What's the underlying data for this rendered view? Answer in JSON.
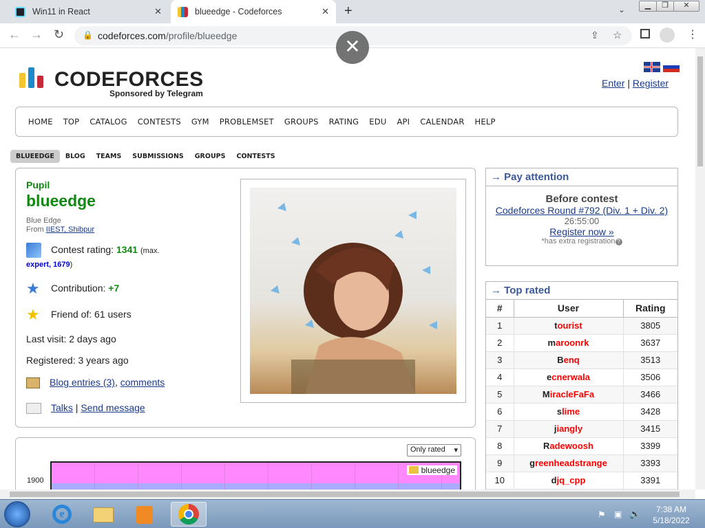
{
  "browser": {
    "tabs": [
      {
        "title": "Win11 in React"
      },
      {
        "title": "blueedge - Codeforces"
      }
    ],
    "url_domain": "codeforces.com",
    "url_path": "/profile/blueedge"
  },
  "site": {
    "logo_text": "CODEFORCES",
    "sponsor": "Sponsored by Telegram",
    "enter": "Enter",
    "register": "Register",
    "menu": [
      "HOME",
      "TOP",
      "CATALOG",
      "CONTESTS",
      "GYM",
      "PROBLEMSET",
      "GROUPS",
      "RATING",
      "EDU",
      "API",
      "CALENDAR",
      "HELP"
    ],
    "subnav": [
      "BLUEEDGE",
      "BLOG",
      "TEAMS",
      "SUBMISSIONS",
      "GROUPS",
      "CONTESTS"
    ]
  },
  "profile": {
    "rank": "Pupil",
    "handle": "blueedge",
    "real_name": "Blue Edge",
    "from_label": "From",
    "organization": "IIEST, Shibpur",
    "contest_rating_label": "Contest rating:",
    "contest_rating": "1341",
    "max_label": "(max.",
    "max_rank": "expert, 1679",
    "max_close": ")",
    "contribution_label": "Contribution:",
    "contribution": "+7",
    "friend_of": "Friend of: 61 users",
    "last_visit": "Last visit: 2 days ago",
    "registered": "Registered: 3 years ago",
    "blog_entries": "Blog entries (3)",
    "comments": "comments",
    "talks": "Talks",
    "send_message": "Send message"
  },
  "chart": {
    "filter": "Only rated",
    "ytick": "1900",
    "legend": "blueedge"
  },
  "pay_attention": {
    "header": "→ Pay attention",
    "before": "Before contest",
    "contest": "Codeforces Round #792 (Div. 1 + Div. 2)",
    "countdown": "26:55:00",
    "register_now": "Register now »",
    "note": "*has extra registration"
  },
  "top_rated": {
    "header": "→ Top rated",
    "columns": [
      "#",
      "User",
      "Rating"
    ],
    "rows": [
      {
        "rank": "1",
        "first": "t",
        "rest": "ourist",
        "rating": "3805"
      },
      {
        "rank": "2",
        "first": "m",
        "rest": "aroonrk",
        "rating": "3637"
      },
      {
        "rank": "3",
        "first": "B",
        "rest": "enq",
        "rating": "3513"
      },
      {
        "rank": "4",
        "first": "e",
        "rest": "cnerwala",
        "rating": "3506"
      },
      {
        "rank": "5",
        "first": "M",
        "rest": "iracleFaFa",
        "rating": "3466"
      },
      {
        "rank": "6",
        "first": "s",
        "rest": "lime",
        "rating": "3428"
      },
      {
        "rank": "7",
        "first": "j",
        "rest": "iangly",
        "rating": "3415"
      },
      {
        "rank": "8",
        "first": "R",
        "rest": "adewoosh",
        "rating": "3399"
      },
      {
        "rank": "9",
        "first": "g",
        "rest": "reenheadstrange",
        "rating": "3393"
      },
      {
        "rank": "10",
        "first": "d",
        "rest": "jq_cpp",
        "rating": "3391"
      }
    ]
  },
  "taskbar": {
    "time": "7:38 AM",
    "date": "5/18/2022"
  }
}
